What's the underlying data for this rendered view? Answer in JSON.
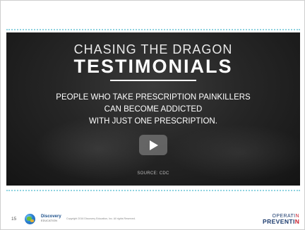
{
  "video": {
    "kicker": "CHASING THE DRAGON",
    "title": "TESTIMONIALS",
    "message_lines": [
      "PEOPLE WHO TAKE PRESCRIPTION PAINKILLERS",
      "CAN BECOME ADDICTED",
      "WITH JUST ONE PRESCRIPTION."
    ],
    "source": "SOURCE: CDC",
    "play_icon": "play-icon"
  },
  "footer": {
    "page_number": "15",
    "brand_name": "Discovery",
    "brand_sub": "EDUCATION",
    "copyright": "Copyright 2016 Discovery Education, Inc. All rights Reserved.",
    "logo_line1_a": "OPERATI",
    "logo_line1_b": "N",
    "logo_line2_a": "PREVENTI",
    "logo_line2_b": "N"
  },
  "colors": {
    "accent_dots": "#8fd3e0",
    "logo_navy": "#1d3c6e",
    "logo_red": "#c8202f"
  }
}
